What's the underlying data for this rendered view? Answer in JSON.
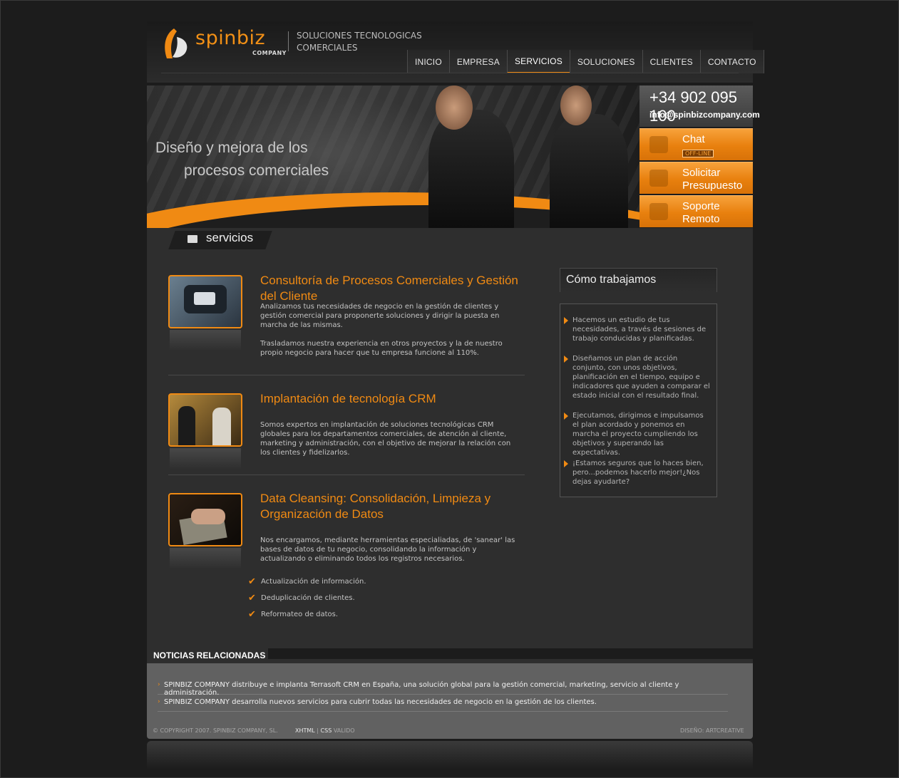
{
  "brand": {
    "name": "spinbiz",
    "sub": "COMPANY",
    "tagline_line1": "SOLUCIONES TECNOLOGICAS",
    "tagline_line2": "COMERCIALES",
    "accent_color": "#f08a13"
  },
  "nav": {
    "items": [
      {
        "label": "INICIO"
      },
      {
        "label": "EMPRESA"
      },
      {
        "label": "SERVICIOS",
        "active": true
      },
      {
        "label": "SOLUCIONES"
      },
      {
        "label": "CLIENTES"
      },
      {
        "label": "CONTACTO"
      }
    ]
  },
  "banner": {
    "line1": "Diseño y mejora de los",
    "line2": "procesos comerciales"
  },
  "contact": {
    "phone": "+34 902 095 100",
    "email": "info@spinbizcompany.com",
    "chat_label": "Chat",
    "chat_status": "OFF-LINE",
    "quote_line1": "Solicitar",
    "quote_line2": "Presupuesto",
    "support_line1": "Soporte",
    "support_line2": "Remoto"
  },
  "section_tab": "servicios",
  "services": [
    {
      "title": "Consultoría de Procesos Comerciales y Gestión del Cliente",
      "p1": "Analizamos tus necesidades de negocio en la gestión de clientes y gestión comercial para proponerte soluciones y dirigir la puesta en marcha de las mismas.",
      "p2": "Trasladamos nuestra experiencia en otros proyectos y la de nuestro propio negocio para hacer que tu empresa funcione al 110%."
    },
    {
      "title": "Implantación de tecnología CRM",
      "p1": "Somos expertos en implantación de soluciones tecnológicas CRM globales para los departamentos comerciales, de atención al cliente, marketing y administración, con el objetivo de mejorar la relación con los clientes y fidelizarlos."
    },
    {
      "title": "Data Cleansing: Consolidación, Limpieza y Organización de Datos",
      "p1": "Nos encargamos, mediante herramientas especialiadas, de 'sanear' las bases de datos de tu negocio, consolidando la información y actualizando o eliminando todos los registros necesarios.",
      "checks": [
        "Actualización de información.",
        "Deduplicación de clientes.",
        "Reformateo de datos."
      ]
    }
  ],
  "how": {
    "title": "Cómo trabajamos",
    "items": [
      "Hacemos un estudio de tus necesidades, a través de sesiones de trabajo conducidas y planificadas.",
      "Diseñamos un plan de acción conjunto, con unos objetivos, planificación en el tiempo, equipo e indicadores que ayuden a comparar el estado inicial con el resultado final.",
      "Ejecutamos, dirigimos e impulsamos el plan acordado y ponemos en marcha el proyecto cumpliendo los objetivos y superando las expectativas.",
      "¡Estamos seguros que lo haces bien, pero...podemos hacerlo mejor!¿Nos dejas ayudarte?"
    ]
  },
  "news": {
    "title": "NOTICIAS RELACIONADAS",
    "items": [
      "SPINBIZ COMPANY distribuye e implanta Terrasoft CRM en España, una solución global para la gestión comercial, marketing, servicio al cliente y administración.",
      "SPINBIZ COMPANY desarrolla nuevos servicios para cubrir todas las necesidades de negocio en la gestión de los clientes."
    ]
  },
  "footer": {
    "copyright": "© COPYRIGHT 2007. SPINBIZ COMPANY, SL.",
    "xhtml": "XHTML",
    "sep": "|",
    "css": "CSS",
    "valid": "VALIDO",
    "design": "DISEÑO: ARTCREATIVE"
  }
}
